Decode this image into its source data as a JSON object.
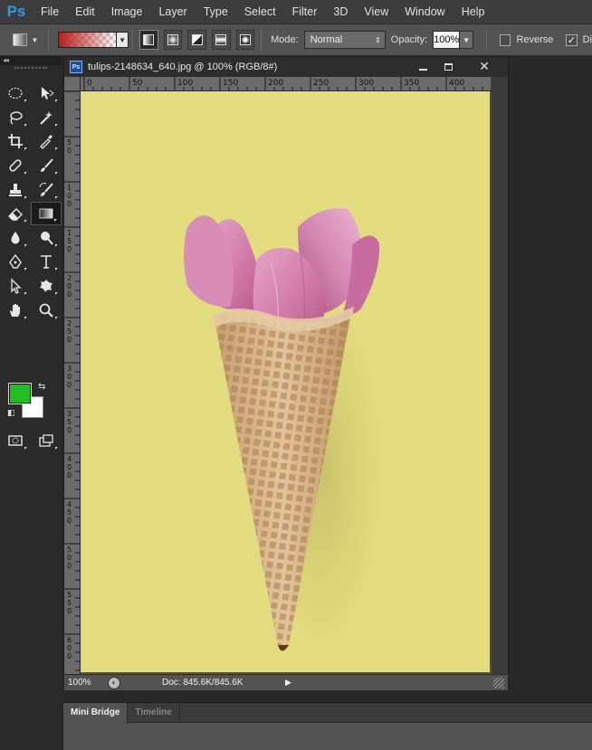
{
  "app": {
    "logo": "Ps",
    "menu": [
      "File",
      "Edit",
      "Image",
      "Layer",
      "Type",
      "Select",
      "Filter",
      "3D",
      "View",
      "Window",
      "Help"
    ]
  },
  "options_bar": {
    "mode_label": "Mode:",
    "mode_value": "Normal",
    "opacity_label": "Opacity:",
    "opacity_value": "100%",
    "reverse_label": "Reverse",
    "dither_label": "Di",
    "gradient_start_color": "#b81c1c"
  },
  "toolbox": {
    "collapse_glyph": "◂◂",
    "foreground_color": "#20c020",
    "background_color": "#ffffff"
  },
  "document": {
    "title": "tulips-2148634_640.jpg @ 100% (RGB/8#)",
    "ps_badge": "Ps",
    "canvas_color": "#e4dd7f",
    "ruler_h_labels": [
      "0",
      "50",
      "100",
      "150",
      "200",
      "250",
      "300",
      "350",
      "400"
    ],
    "ruler_v_labels": [
      "5\n0",
      "1\n0\n0",
      "1\n5\n0",
      "2\n0\n0",
      "2\n5\n0",
      "3\n0\n0",
      "3\n5\n0",
      "4\n0\n0",
      "4\n5\n0",
      "5\n0\n0",
      "5\n5\n0",
      "6\n0\n0"
    ]
  },
  "status": {
    "zoom": "100%",
    "doc_size": "Doc: 845.6K/845.6K"
  },
  "bottom_panel": {
    "tabs": [
      "Mini Bridge",
      "Timeline"
    ]
  }
}
